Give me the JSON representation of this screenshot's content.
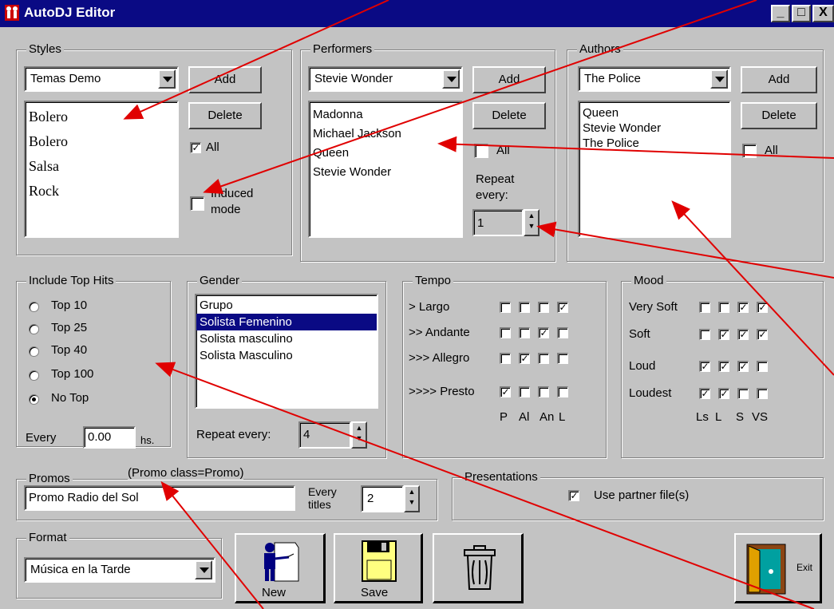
{
  "window": {
    "title": "AutoDJ Editor",
    "controls": [
      "_",
      "□",
      "X"
    ]
  },
  "styles": {
    "label": "Styles",
    "combo_value": "Temas Demo",
    "add": "Add",
    "delete": "Delete",
    "items": [
      "Bolero",
      "Bolero",
      "Salsa",
      "Rock"
    ],
    "all_label": "All",
    "all_checked": true,
    "induced_label_1": "Induced",
    "induced_label_2": "mode",
    "induced_checked": false
  },
  "performers": {
    "label": "Performers",
    "combo_value": "Stevie Wonder",
    "add": "Add",
    "delete": "Delete",
    "items": [
      "Madonna",
      "Michael Jackson",
      "Queen",
      "Stevie Wonder"
    ],
    "all_label": "All",
    "all_checked": false,
    "repeat_label_1": "Repeat",
    "repeat_label_2": "every:",
    "repeat_value": "1"
  },
  "authors": {
    "label": "Authors",
    "combo_value": "The Police",
    "add": "Add",
    "delete": "Delete",
    "items": [
      "Queen",
      "Stevie Wonder",
      "The Police"
    ],
    "all_label": "All",
    "all_checked": false
  },
  "top_hits": {
    "label": "Include Top Hits",
    "options": [
      {
        "label": "Top 10",
        "selected": false
      },
      {
        "label": "Top 25",
        "selected": false
      },
      {
        "label": "Top 40",
        "selected": false
      },
      {
        "label": "Top 100",
        "selected": false
      },
      {
        "label": "No Top",
        "selected": true
      }
    ],
    "every_label": "Every",
    "every_value": "0.00",
    "unit": "hs."
  },
  "gender": {
    "label": "Gender",
    "items": [
      "Grupo",
      "Solista Femenino",
      "Solista masculino",
      "Solista Masculino"
    ],
    "selected_index": 1,
    "repeat_label": "Repeat every:",
    "repeat_value": "4"
  },
  "tempo": {
    "label": "Tempo",
    "rows": [
      {
        "label": "> Largo",
        "checks": [
          false,
          false,
          false,
          true
        ]
      },
      {
        "label": ">> Andante",
        "checks": [
          false,
          false,
          true,
          false
        ]
      },
      {
        "label": ">>> Allegro",
        "checks": [
          false,
          true,
          false,
          false
        ]
      },
      {
        "label": ">>>> Presto",
        "checks": [
          true,
          false,
          false,
          false
        ]
      }
    ],
    "columns": [
      "P",
      "Al",
      "An",
      "L"
    ]
  },
  "mood": {
    "label": "Mood",
    "rows": [
      {
        "label": "Very Soft",
        "checks": [
          false,
          false,
          true,
          true
        ]
      },
      {
        "label": "Soft",
        "checks": [
          false,
          true,
          true,
          true
        ]
      },
      {
        "label": "Loud",
        "checks": [
          true,
          true,
          true,
          false
        ]
      },
      {
        "label": "Loudest",
        "checks": [
          true,
          true,
          false,
          false
        ]
      }
    ],
    "columns": [
      "Ls",
      "L",
      "S",
      "VS"
    ]
  },
  "promos": {
    "label": "Promos",
    "class_note": "(Promo class=Promo)",
    "value": "Promo Radio del Sol",
    "every_label_1": "Every",
    "every_label_2": "titles",
    "every_value": "2"
  },
  "presentations": {
    "label": "Presentations",
    "partner_label": "Use partner file(s)",
    "partner_checked": true
  },
  "format": {
    "label": "Format",
    "combo_value": "Música en la Tarde"
  },
  "toolbar": {
    "new_label": "New",
    "save_label": "Save",
    "exit_label": "Exit"
  },
  "colors": {
    "titlebar": "#0a0a84",
    "face": "#c3c3c3",
    "annotation": "#e00000"
  }
}
